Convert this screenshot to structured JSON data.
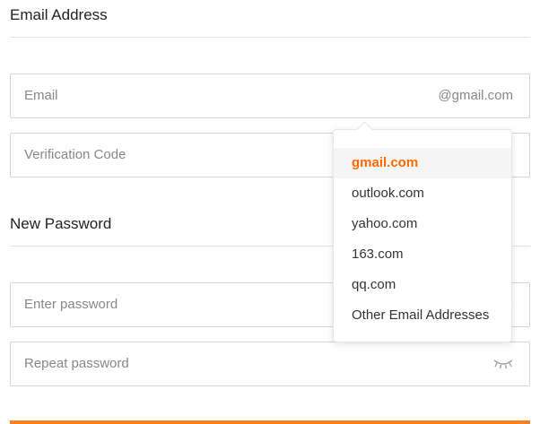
{
  "sections": {
    "email_title": "Email Address",
    "password_title": "New Password"
  },
  "fields": {
    "email": {
      "placeholder": "Email",
      "suffix": "@gmail.com"
    },
    "code": {
      "placeholder": "Verification Code"
    },
    "password": {
      "placeholder": "Enter password"
    },
    "repeat": {
      "placeholder": "Repeat password"
    }
  },
  "dropdown": {
    "items": [
      {
        "label": "gmail.com",
        "selected": true
      },
      {
        "label": "outlook.com"
      },
      {
        "label": "yahoo.com"
      },
      {
        "label": "163.com"
      },
      {
        "label": "qq.com"
      },
      {
        "label": "Other Email Addresses"
      }
    ]
  },
  "colors": {
    "accent": "#ff6a00",
    "border": "#d4d4d4"
  },
  "icons": {
    "password_visibility": "eye-closed-icon"
  }
}
